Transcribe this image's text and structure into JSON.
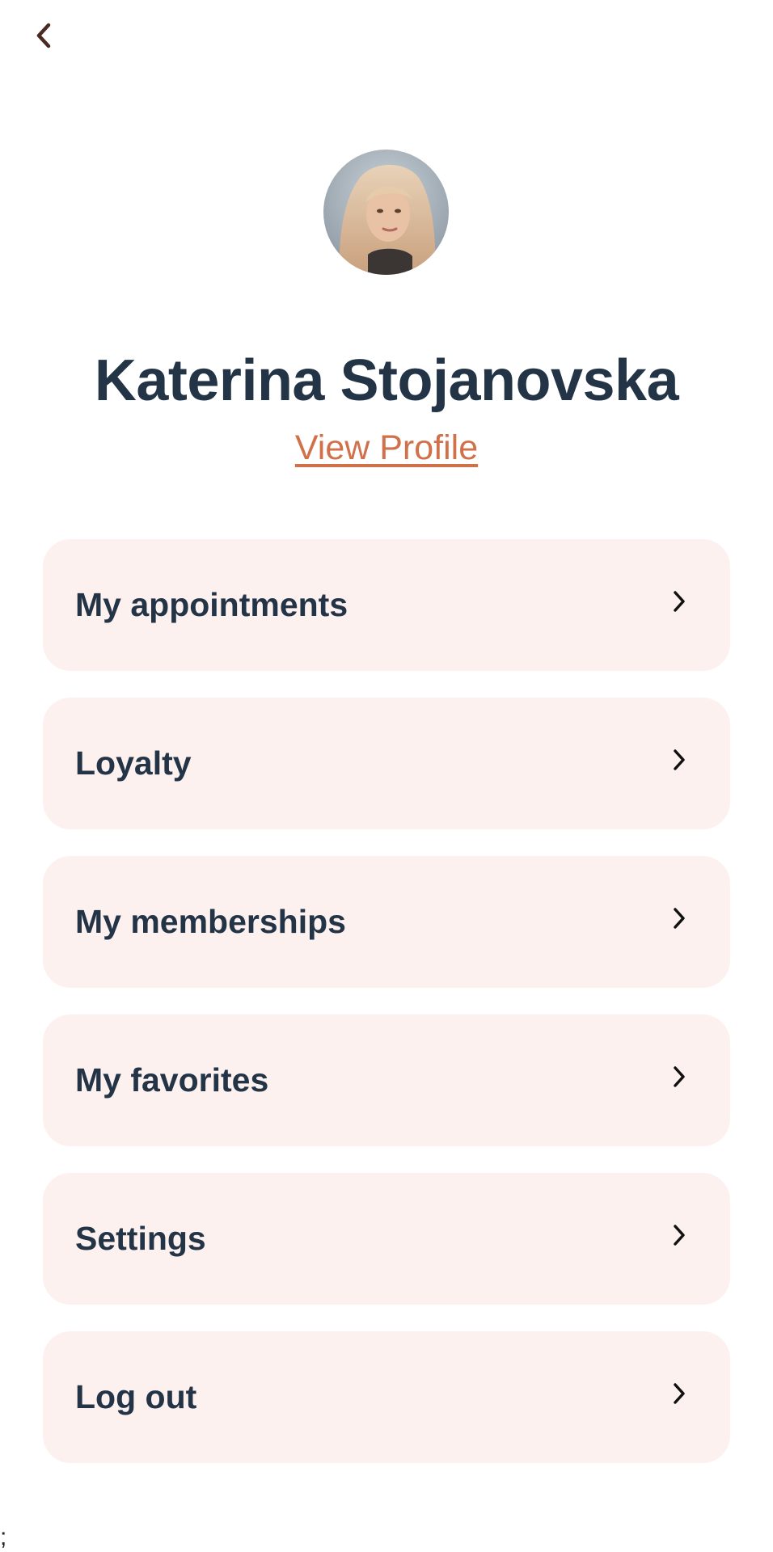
{
  "header": {
    "back_icon": "chevron-left-icon"
  },
  "profile": {
    "name": "Katerina Stojanovska",
    "view_profile_label": "View Profile",
    "link_color": "#d0714a"
  },
  "menu": {
    "item_background": "#fdf1ef",
    "items": [
      {
        "label": "My appointments",
        "icon": "chevron-right-icon"
      },
      {
        "label": "Loyalty",
        "icon": "chevron-right-icon"
      },
      {
        "label": "My memberships",
        "icon": "chevron-right-icon"
      },
      {
        "label": "My favorites",
        "icon": "chevron-right-icon"
      },
      {
        "label": "Settings",
        "icon": "chevron-right-icon"
      },
      {
        "label": "Log out",
        "icon": "chevron-right-icon"
      }
    ]
  },
  "footer": {
    "stray_text": ";"
  }
}
